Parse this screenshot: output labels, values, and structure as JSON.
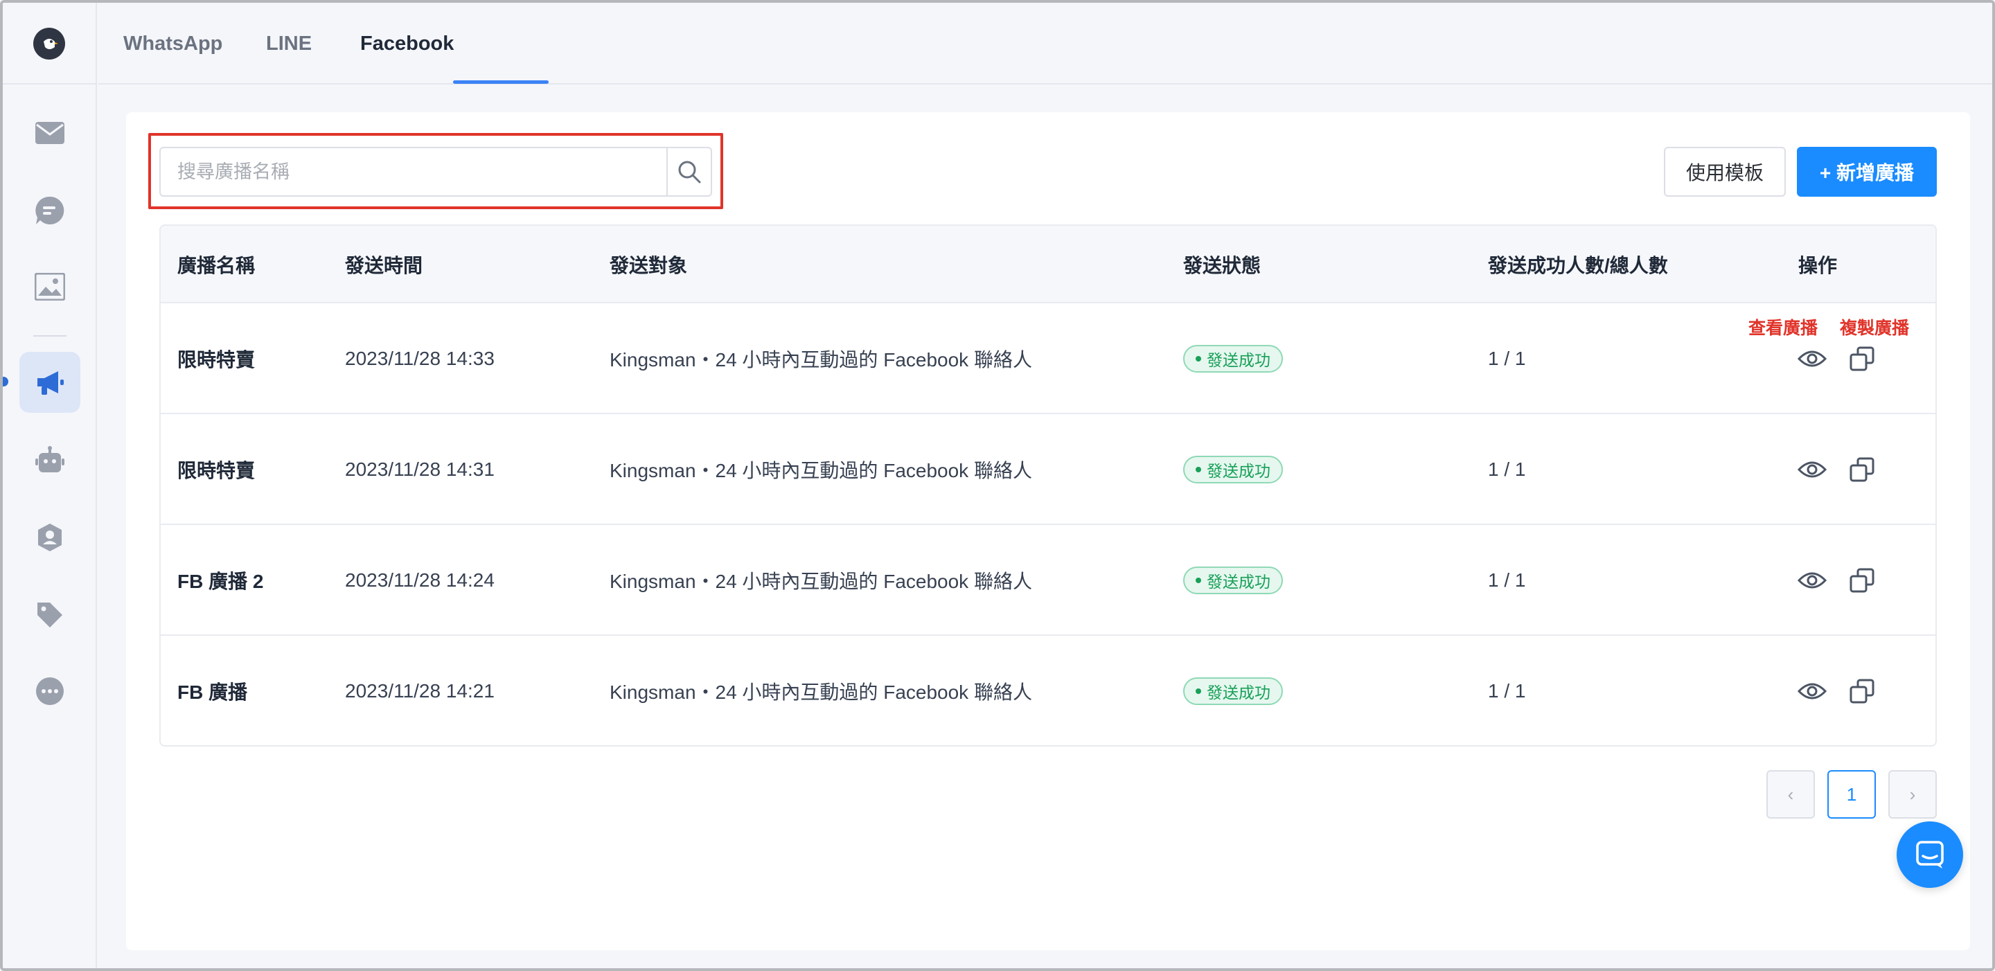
{
  "tabs": [
    {
      "label": "WhatsApp"
    },
    {
      "label": "LINE"
    },
    {
      "label": "Facebook",
      "active": true
    }
  ],
  "sidebar": {
    "items": [
      {
        "icon": "mail-icon"
      },
      {
        "icon": "chat-icon"
      },
      {
        "icon": "image-icon"
      },
      {
        "icon": "megaphone-icon",
        "active": true
      },
      {
        "icon": "bot-icon"
      },
      {
        "icon": "contact-shield-icon"
      },
      {
        "icon": "tag-icon"
      },
      {
        "icon": "more-icon"
      }
    ]
  },
  "search": {
    "placeholder": "搜尋廣播名稱",
    "value": ""
  },
  "toolbar": {
    "template_label": "使用模板",
    "new_label": "+ 新增廣播"
  },
  "annotations": {
    "view": "查看廣播",
    "copy": "複製廣播"
  },
  "table": {
    "headers": [
      "廣播名稱",
      "發送時間",
      "發送對象",
      "發送狀態",
      "發送成功人數/總人數",
      "操作"
    ],
    "rows": [
      {
        "name": "限時特賣",
        "time": "2023/11/28 14:33",
        "target": "Kingsman・24 小時內互動過的 Facebook 聯絡人",
        "status": "發送成功",
        "count": "1 / 1"
      },
      {
        "name": "限時特賣",
        "time": "2023/11/28 14:31",
        "target": "Kingsman・24 小時內互動過的 Facebook 聯絡人",
        "status": "發送成功",
        "count": "1 / 1"
      },
      {
        "name": "FB 廣播 2",
        "time": "2023/11/28 14:24",
        "target": "Kingsman・24 小時內互動過的 Facebook 聯絡人",
        "status": "發送成功",
        "count": "1 / 1"
      },
      {
        "name": "FB 廣播",
        "time": "2023/11/28 14:21",
        "target": "Kingsman・24 小時內互動過的 Facebook 聯絡人",
        "status": "發送成功",
        "count": "1 / 1"
      }
    ]
  },
  "pagination": {
    "prev": "‹",
    "current": "1",
    "next": "›"
  },
  "colors": {
    "accent": "#1a8cff",
    "success": "#18a058",
    "highlight": "#e0332a"
  }
}
